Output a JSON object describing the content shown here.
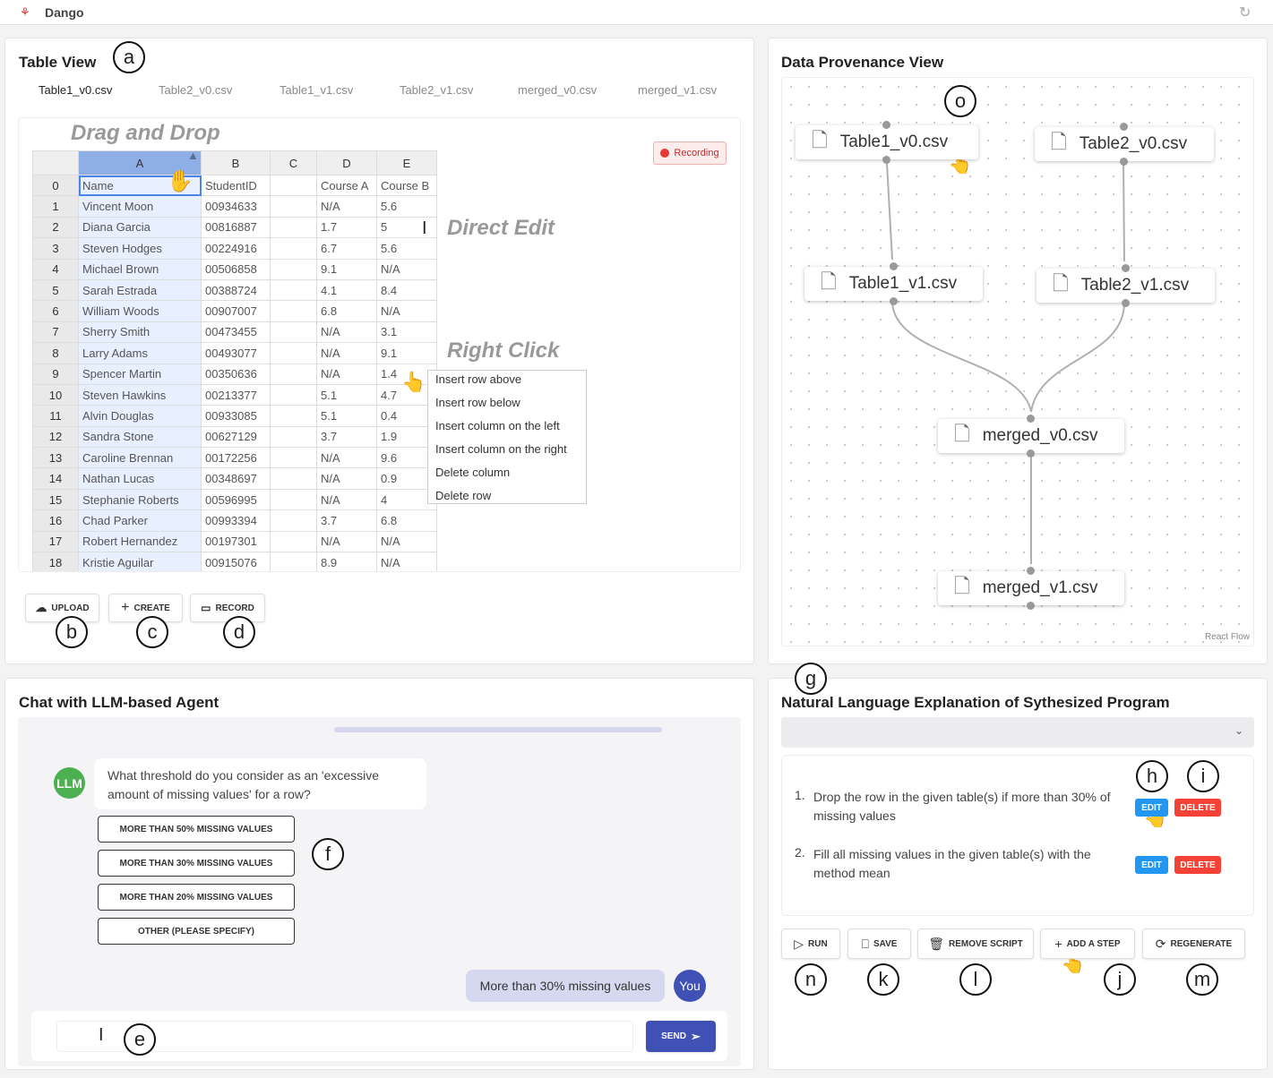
{
  "app": {
    "title": "Dango"
  },
  "table_view": {
    "title": "Table View",
    "tabs": [
      "Table1_v0.csv",
      "Table2_v0.csv",
      "Table1_v1.csv",
      "Table2_v1.csv",
      "merged_v0.csv",
      "merged_v1.csv"
    ],
    "recording": "Recording",
    "recording_color": "#e53935",
    "annotations": {
      "drag": "Drag and Drop",
      "edit": "Direct Edit",
      "right": "Right Click"
    },
    "columns": [
      "A",
      "B",
      "C",
      "D",
      "E"
    ],
    "rows": [
      [
        "0",
        "Name",
        "StudentID",
        "",
        "Course A",
        "Course B"
      ],
      [
        "1",
        "Vincent Moon",
        "00934633",
        "",
        "N/A",
        "5.6"
      ],
      [
        "2",
        "Diana Garcia",
        "00816887",
        "",
        "1.7",
        "5"
      ],
      [
        "3",
        "Steven Hodges",
        "00224916",
        "",
        "6.7",
        "5.6"
      ],
      [
        "4",
        "Michael Brown",
        "00506858",
        "",
        "9.1",
        "N/A"
      ],
      [
        "5",
        "Sarah Estrada",
        "00388724",
        "",
        "4.1",
        "8.4"
      ],
      [
        "6",
        "William Woods",
        "00907007",
        "",
        "6.8",
        "N/A"
      ],
      [
        "7",
        "Sherry Smith",
        "00473455",
        "",
        "N/A",
        "3.1"
      ],
      [
        "8",
        "Larry Adams",
        "00493077",
        "",
        "N/A",
        "9.1"
      ],
      [
        "9",
        "Spencer Martin",
        "00350636",
        "",
        "N/A",
        "1.4"
      ],
      [
        "10",
        "Steven Hawkins",
        "00213377",
        "",
        "5.1",
        "4.7"
      ],
      [
        "11",
        "Alvin Douglas",
        "00933085",
        "",
        "5.1",
        "0.4"
      ],
      [
        "12",
        "Sandra Stone",
        "00627129",
        "",
        "3.7",
        "1.9"
      ],
      [
        "13",
        "Caroline Brennan",
        "00172256",
        "",
        "N/A",
        "9.6"
      ],
      [
        "14",
        "Nathan Lucas",
        "00348697",
        "",
        "N/A",
        "0.9"
      ],
      [
        "15",
        "Stephanie Roberts",
        "00596995",
        "",
        "N/A",
        "4"
      ],
      [
        "16",
        "Chad Parker",
        "00993394",
        "",
        "3.7",
        "6.8"
      ],
      [
        "17",
        "Robert Hernandez",
        "00197301",
        "",
        "N/A",
        "N/A"
      ],
      [
        "18",
        "Kristie Aguilar",
        "00915076",
        "",
        "8.9",
        "N/A"
      ]
    ],
    "context_menu": [
      "Insert row above",
      "Insert row below",
      "Insert column on the left",
      "Insert column on the right",
      "Delete column",
      "Delete row"
    ],
    "buttons": {
      "upload": "UPLOAD",
      "create": "CREATE",
      "record": "RECORD"
    }
  },
  "provenance": {
    "title": "Data Provenance View",
    "nodes": [
      "Table1_v0.csv",
      "Table2_v0.csv",
      "Table1_v1.csv",
      "Table2_v1.csv",
      "merged_v0.csv",
      "merged_v1.csv"
    ],
    "attribution": "React Flow"
  },
  "chat": {
    "title": "Chat with LLM-based Agent",
    "llm_avatar": "LLM",
    "llm_color": "#4caf50",
    "question": "What threshold do you consider as an 'excessive amount of missing values' for a row?",
    "options": [
      "MORE THAN 50% MISSING VALUES",
      "MORE THAN 30% MISSING VALUES",
      "MORE THAN 20% MISSING VALUES",
      "OTHER (PLEASE SPECIFY)"
    ],
    "user_message": "More than 30% missing values",
    "user_avatar": "You",
    "user_color": "#3f51b5",
    "input_value": "",
    "send": "SEND"
  },
  "explanation": {
    "title": "Natural Language Explanation of Sythesized Program",
    "dropdown_value": "",
    "steps": [
      {
        "num": "1.",
        "text": "Drop the row in the given table(s) if more than 30% of missing values"
      },
      {
        "num": "2.",
        "text": "Fill all missing values in the given table(s) with the method mean"
      }
    ],
    "edit": "EDIT",
    "delete": "DELETE",
    "edit_color": "#2196f3",
    "delete_color": "#f44336",
    "buttons": {
      "run": "RUN",
      "save": "SAVE",
      "remove": "REMOVE SCRIPT",
      "add": "ADD A STEP",
      "regenerate": "REGENERATE"
    }
  },
  "labels": {
    "a": "a",
    "b": "b",
    "c": "c",
    "d": "d",
    "e": "e",
    "f": "f",
    "g": "g",
    "h": "h",
    "i": "i",
    "j": "j",
    "k": "k",
    "l": "l",
    "m": "m",
    "n": "n",
    "o": "o"
  }
}
